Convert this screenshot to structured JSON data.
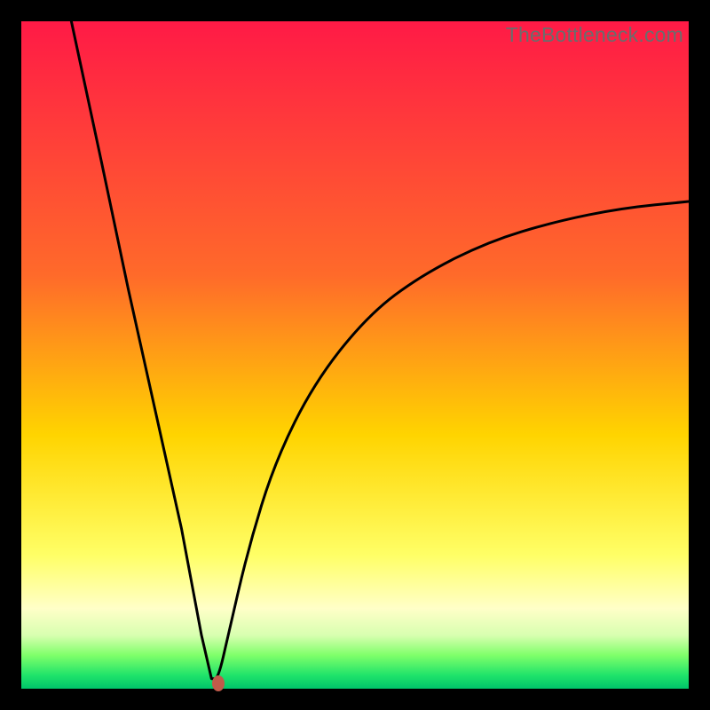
{
  "watermark": "TheBottleneck.com",
  "colors": {
    "bg_black": "#000000",
    "red_top": "#ff1a46",
    "orange_mid": "#ff8a26",
    "yellow": "#ffe900",
    "pale_yellow": "#ffffb0",
    "green_light": "#9fff6a",
    "green_mid": "#2fe36a",
    "green_deep": "#00c46a",
    "curve": "#000000",
    "marker": "#c05a4a",
    "watermark_text": "#6c6c6c"
  },
  "chart_data": {
    "type": "line",
    "title": "",
    "xlabel": "",
    "ylabel": "",
    "x_range": [
      0,
      100
    ],
    "y_range": [
      0,
      100
    ],
    "description": "V-shaped bottleneck curve on rainbow vertical gradient. Minimum near x≈29, y≈0. Left branch steep (starts near top at x≈7.5). Right branch concave, ends near y≈73 at x=100.",
    "series": [
      {
        "name": "bottleneck-curve",
        "x": [
          7.5,
          12,
          16,
          20,
          24,
          27,
          28.5,
          29.5,
          31,
          34,
          38,
          44,
          52,
          60,
          70,
          80,
          90,
          100
        ],
        "y": [
          100,
          79,
          60,
          42,
          24,
          8,
          1.5,
          1.5,
          8,
          21,
          34,
          46,
          56,
          62,
          67,
          70,
          72,
          73
        ]
      }
    ],
    "marker": {
      "x": 29.5,
      "y": 0.8
    },
    "gradient_stops_pct": [
      {
        "pct": 0,
        "color": "#ff1a46"
      },
      {
        "pct": 38,
        "color": "#ff6a2a"
      },
      {
        "pct": 62,
        "color": "#ffd400"
      },
      {
        "pct": 80,
        "color": "#ffff66"
      },
      {
        "pct": 88,
        "color": "#ffffc8"
      },
      {
        "pct": 92,
        "color": "#d8ffb0"
      },
      {
        "pct": 95,
        "color": "#7fff6a"
      },
      {
        "pct": 98,
        "color": "#1fe36a"
      },
      {
        "pct": 100,
        "color": "#00c46a"
      }
    ]
  }
}
